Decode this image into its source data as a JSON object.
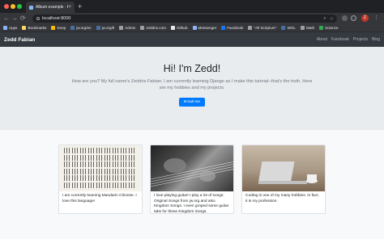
{
  "browser": {
    "tab_title": "Album example · Bootstrap",
    "tab_close": "×",
    "new_tab": "+",
    "url": "localhost:8000",
    "back": "←",
    "forward": "→",
    "reload": "⟳",
    "avatar_letter": "Z",
    "menu": "⋮",
    "bookmarks": [
      {
        "label": "Apps",
        "color": "#8ab4f8"
      },
      {
        "label": "Bookmarks",
        "color": "#fdd663"
      },
      {
        "label": "Keep",
        "color": "#fbbc04"
      },
      {
        "label": "jw.org/en",
        "color": "#4a6fa5"
      },
      {
        "label": "jw.org/tl",
        "color": "#4a6fa5"
      },
      {
        "label": "Admin",
        "color": "#9aa0a6"
      },
      {
        "label": "zeddrix.com",
        "color": "#9aa0a6"
      },
      {
        "label": "Github",
        "color": "#e8eaed"
      },
      {
        "label": "Messenger",
        "color": "#8ab4f8"
      },
      {
        "label": "Facebook",
        "color": "#1877f2"
      },
      {
        "label": "\"All Scripture\"",
        "color": "#9aa0a6"
      },
      {
        "label": "WOL",
        "color": "#4a6fa5"
      },
      {
        "label": "Math",
        "color": "#9aa0a6"
      },
      {
        "label": "Science",
        "color": "#34a853"
      }
    ]
  },
  "navbar": {
    "brand": "Zedd Fabian",
    "links": [
      "About",
      "Facebook",
      "Projects",
      "Blog"
    ]
  },
  "jumbotron": {
    "heading": "Hi! I'm Zedd!",
    "lead": "How are you? My full name's Zeddrix Fabian. I am currently learning Django as I make this tutorial--that's the truth. Here are my hobbies and my projects.",
    "button": "Email me"
  },
  "cards": [
    {
      "text": "I am currently learning Mandarin Chinese. I love this language!"
    },
    {
      "text": "I love playing guitar! I play a lot of songs: Original Songs from jw.org and also Kingdom Songs. I even groped some guitar tabs for these Kingdom Songs."
    },
    {
      "text": "Coding is one of my many hobbies. In fact, it is my profession."
    }
  ]
}
